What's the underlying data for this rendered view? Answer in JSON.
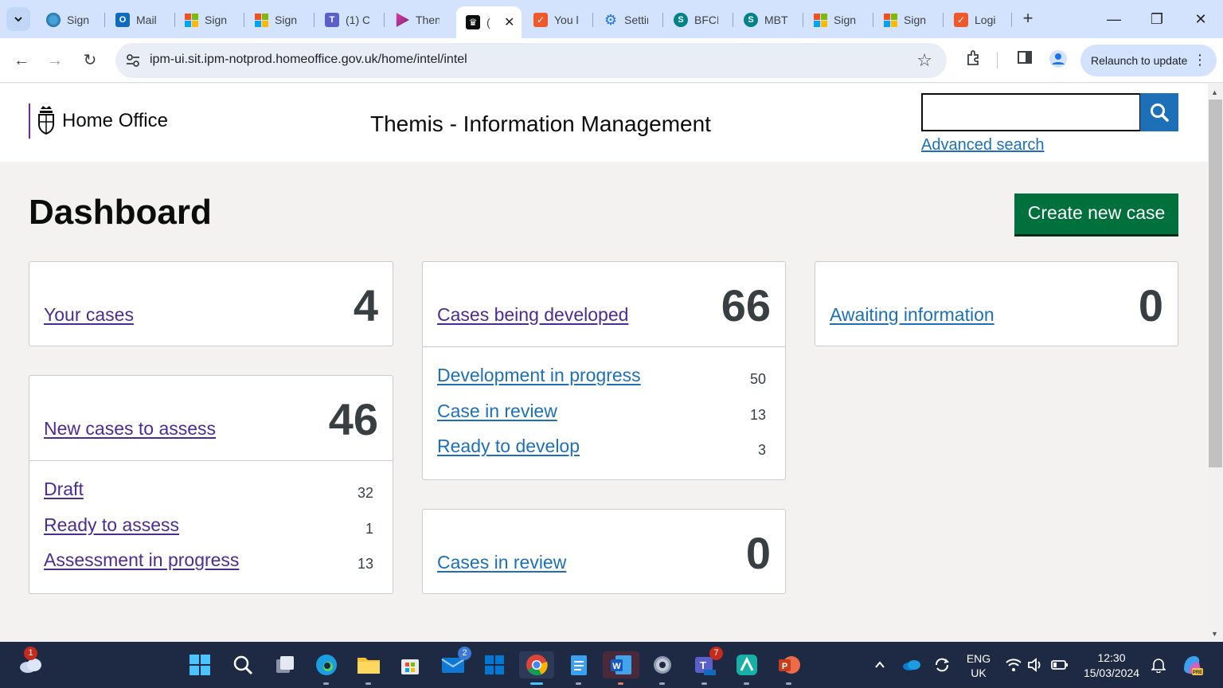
{
  "browser": {
    "tabs": [
      {
        "title": "Sign",
        "icon": "edge-sign-icon"
      },
      {
        "title": "Mail",
        "icon": "outlook-icon"
      },
      {
        "title": "Sign",
        "icon": "microsoft-icon"
      },
      {
        "title": "Sign",
        "icon": "microsoft-icon"
      },
      {
        "title": "(1) C",
        "icon": "teams-icon"
      },
      {
        "title": "Then",
        "icon": "power-apps-icon"
      },
      {
        "title": "(",
        "icon": "home-office-crest-icon",
        "active": true
      },
      {
        "title": "You l",
        "icon": "checkmark-app-icon"
      },
      {
        "title": "Settir",
        "icon": "gear-icon"
      },
      {
        "title": "BFCN",
        "icon": "sharepoint-icon"
      },
      {
        "title": "MBTI",
        "icon": "sharepoint-icon"
      },
      {
        "title": "Sign",
        "icon": "microsoft-icon"
      },
      {
        "title": "Sign",
        "icon": "microsoft-icon"
      },
      {
        "title": "Logi",
        "icon": "checkmark-app-icon"
      }
    ],
    "url": "ipm-ui.sit.ipm-notprod.homeoffice.gov.uk/home/intel/intel",
    "relaunch_label": "Relaunch to update"
  },
  "header": {
    "logo_text": "Home Office",
    "service_name": "Themis - Information Management",
    "search_value": "",
    "advanced_search": "Advanced search"
  },
  "main": {
    "title": "Dashboard",
    "create_button": "Create new case",
    "cards": {
      "your_cases": {
        "label": "Your cases",
        "count": "4"
      },
      "new_cases": {
        "label": "New cases to assess",
        "count": "46",
        "items": [
          {
            "label": "Draft",
            "count": "32"
          },
          {
            "label": "Ready to assess",
            "count": "1"
          },
          {
            "label": "Assessment in progress",
            "count": "13"
          }
        ]
      },
      "being_developed": {
        "label": "Cases being developed",
        "count": "66",
        "items": [
          {
            "label": "Development in progress",
            "count": "50"
          },
          {
            "label": "Case in review",
            "count": "13"
          },
          {
            "label": "Ready to develop",
            "count": "3"
          }
        ]
      },
      "in_review": {
        "label": "Cases in review",
        "count": "0"
      },
      "awaiting": {
        "label": "Awaiting information",
        "count": "0"
      }
    }
  },
  "taskbar": {
    "weather_badge": "1",
    "mail_badge": "2",
    "teams_badge": "7",
    "language": "ENG",
    "region": "UK",
    "time": "12:30",
    "date": "15/03/2024"
  },
  "colors": {
    "link": "#1d70b8",
    "visited_link": "#4c2c92",
    "primary_button": "#00703c",
    "search_button": "#1d70b8",
    "count_text": "#383f43"
  }
}
